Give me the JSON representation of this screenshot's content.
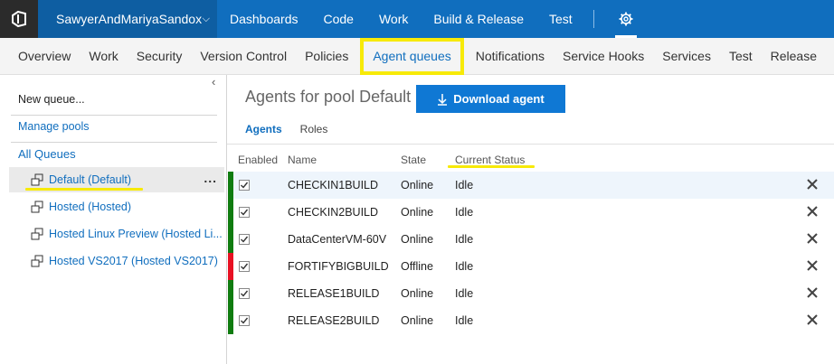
{
  "topbar": {
    "account": "SawyerAndMariyaSandox",
    "nav": [
      "Dashboards",
      "Code",
      "Work",
      "Build & Release",
      "Test"
    ]
  },
  "subnav": {
    "items": [
      "Overview",
      "Work",
      "Security",
      "Version Control",
      "Policies",
      "Agent queues",
      "Notifications",
      "Service Hooks",
      "Services",
      "Test",
      "Release"
    ],
    "active": "Agent queues"
  },
  "left": {
    "new_queue": "New queue...",
    "manage_pools": "Manage pools",
    "all_queues": "All Queues",
    "queues": [
      "Default (Default)",
      "Hosted (Hosted)",
      "Hosted Linux Preview (Hosted Li...",
      "Hosted VS2017 (Hosted VS2017)"
    ],
    "more": "..."
  },
  "main": {
    "title": "Agents for pool Default",
    "download_label": "Download agent",
    "tabs": [
      "Agents",
      "Roles"
    ],
    "columns": [
      "Enabled",
      "Name",
      "State",
      "Current Status"
    ],
    "agents": [
      {
        "name": "CHECKIN1BUILD",
        "state": "Online",
        "status": "Idle"
      },
      {
        "name": "CHECKIN2BUILD",
        "state": "Online",
        "status": "Idle"
      },
      {
        "name": "DataCenterVM-60V",
        "state": "Online",
        "status": "Idle"
      },
      {
        "name": "FORTIFYBIGBUILD",
        "state": "Offline",
        "status": "Idle"
      },
      {
        "name": "RELEASE1BUILD",
        "state": "Online",
        "status": "Idle"
      },
      {
        "name": "RELEASE2BUILD",
        "state": "Online",
        "status": "Idle"
      }
    ]
  },
  "colors": {
    "accent": "#106ebe",
    "online": "#107c10",
    "offline": "#e81123",
    "highlight": "#f7ea08"
  }
}
